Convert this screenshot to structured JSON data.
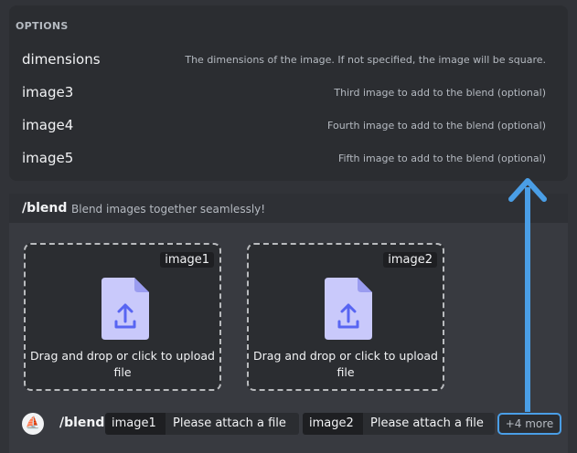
{
  "options": {
    "header": "OPTIONS",
    "items": [
      {
        "name": "dimensions",
        "description": "The dimensions of the image. If not specified, the image will be square."
      },
      {
        "name": "image3",
        "description": "Third image to add to the blend (optional)"
      },
      {
        "name": "image4",
        "description": "Fourth image to add to the blend (optional)"
      },
      {
        "name": "image5",
        "description": "Fifth image to add to the blend (optional)"
      }
    ]
  },
  "blend": {
    "command": "/blend",
    "description": "Blend images together seamlessly!",
    "dropzones": [
      {
        "tag": "image1",
        "text": "Drag and drop or click to upload file"
      },
      {
        "tag": "image2",
        "text": "Drag and drop or click to upload file"
      }
    ]
  },
  "command_bar": {
    "logo_icon": "sailboat-icon",
    "command": "/blend",
    "params": [
      {
        "key": "image1",
        "value": "Please attach a file"
      },
      {
        "key": "image2",
        "value": "Please attach a file"
      }
    ],
    "more": "+4 more"
  },
  "colors": {
    "accent_arrow": "#4a9ee6",
    "upload_icon": "#c9c9fb"
  }
}
